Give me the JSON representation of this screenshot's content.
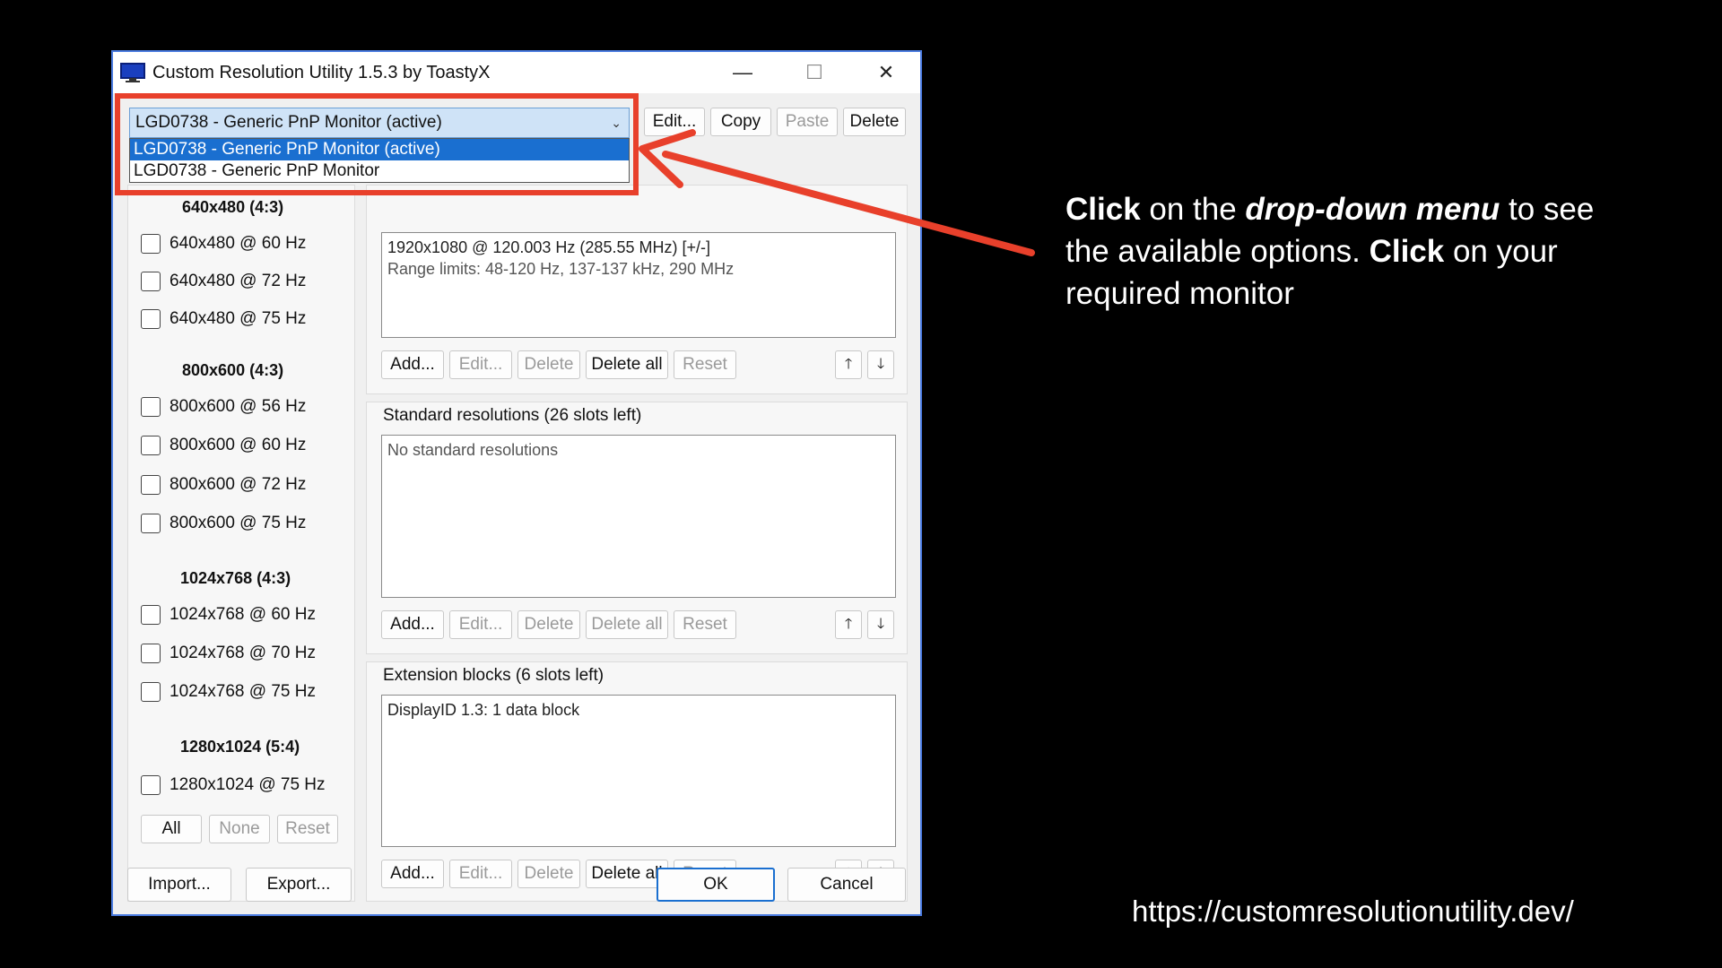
{
  "window": {
    "title": "Custom Resolution Utility 1.5.3 by ToastyX",
    "controls": {
      "minimize": "—",
      "maximize": "☐",
      "close": "✕"
    }
  },
  "monitor_select": {
    "value": "LGD0738 - Generic PnP Monitor (active)",
    "options": [
      "LGD0738 - Generic PnP Monitor (active)",
      "LGD0738 - Generic PnP Monitor"
    ]
  },
  "top_buttons": {
    "edit": "Edit...",
    "copy": "Copy",
    "paste": "Paste",
    "delete": "Delete"
  },
  "left_panel": {
    "groups": [
      {
        "title": "640x480 (4:3)",
        "items": [
          "640x480 @ 60 Hz",
          "640x480 @ 72 Hz",
          "640x480 @ 75 Hz"
        ]
      },
      {
        "title": "800x600 (4:3)",
        "items": [
          "800x600 @ 56 Hz",
          "800x600 @ 60 Hz",
          "800x600 @ 72 Hz",
          "800x600 @ 75 Hz"
        ]
      },
      {
        "title": "1024x768 (4:3)",
        "items": [
          "1024x768 @ 60 Hz",
          "1024x768 @ 70 Hz",
          "1024x768 @ 75 Hz"
        ]
      },
      {
        "title": "1280x1024 (5:4)",
        "items": [
          "1280x1024 @ 75 Hz"
        ]
      }
    ],
    "buttons": {
      "all": "All",
      "none": "None",
      "reset": "Reset"
    }
  },
  "detailed": {
    "line1": "1920x1080 @ 120.003 Hz (285.55 MHz) [+/-]",
    "line2": "Range limits: 48-120 Hz, 137-137 kHz, 290 MHz"
  },
  "standard": {
    "label": "Standard resolutions (26 slots left)",
    "content": "No standard resolutions"
  },
  "extension": {
    "label": "Extension blocks (6 slots left)",
    "content": "DisplayID 1.3: 1 data block"
  },
  "section_buttons": {
    "add": "Add...",
    "edit": "Edit...",
    "delete": "Delete",
    "delete_all": "Delete all",
    "reset": "Reset",
    "up": "🡑",
    "down": "🡓"
  },
  "bottom_buttons": {
    "import": "Import...",
    "export": "Export...",
    "ok": "OK",
    "cancel": "Cancel"
  },
  "annotation": {
    "p1_bold": "Click",
    "p2": " on the ",
    "p3_bold_italic": "drop-down menu",
    "p4": " to see the available options. ",
    "p5_bold": "Click",
    "p6": " on your required monitor"
  },
  "url": "https://customresolutionutility.dev/",
  "colors": {
    "highlight_box": "#e8402b",
    "selection": "#1a6fd0"
  }
}
